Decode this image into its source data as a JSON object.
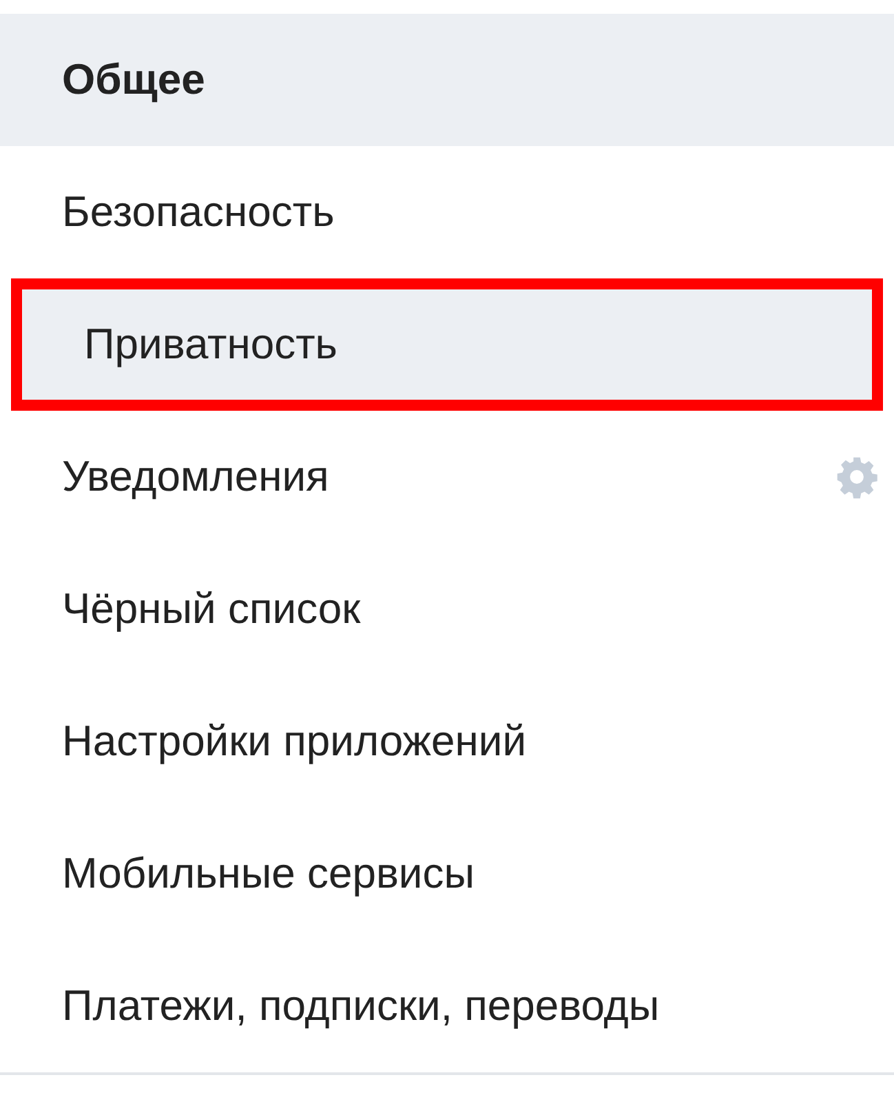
{
  "menu": [
    {
      "label": "Общее",
      "selected": true,
      "outlined": false,
      "settings_icon": false
    },
    {
      "label": "Безопасность",
      "selected": false,
      "outlined": false,
      "settings_icon": false
    },
    {
      "label": "Приватность",
      "selected": false,
      "outlined": true,
      "settings_icon": false
    },
    {
      "label": "Уведомления",
      "selected": false,
      "outlined": false,
      "settings_icon": true
    },
    {
      "label": "Чёрный список",
      "selected": false,
      "outlined": false,
      "settings_icon": false
    },
    {
      "label": "Настройки приложений",
      "selected": false,
      "outlined": false,
      "settings_icon": false
    },
    {
      "label": "Мобильные сервисы",
      "selected": false,
      "outlined": false,
      "settings_icon": false
    },
    {
      "label": "Платежи, подписки, переводы",
      "selected": false,
      "outlined": false,
      "settings_icon": false
    }
  ]
}
